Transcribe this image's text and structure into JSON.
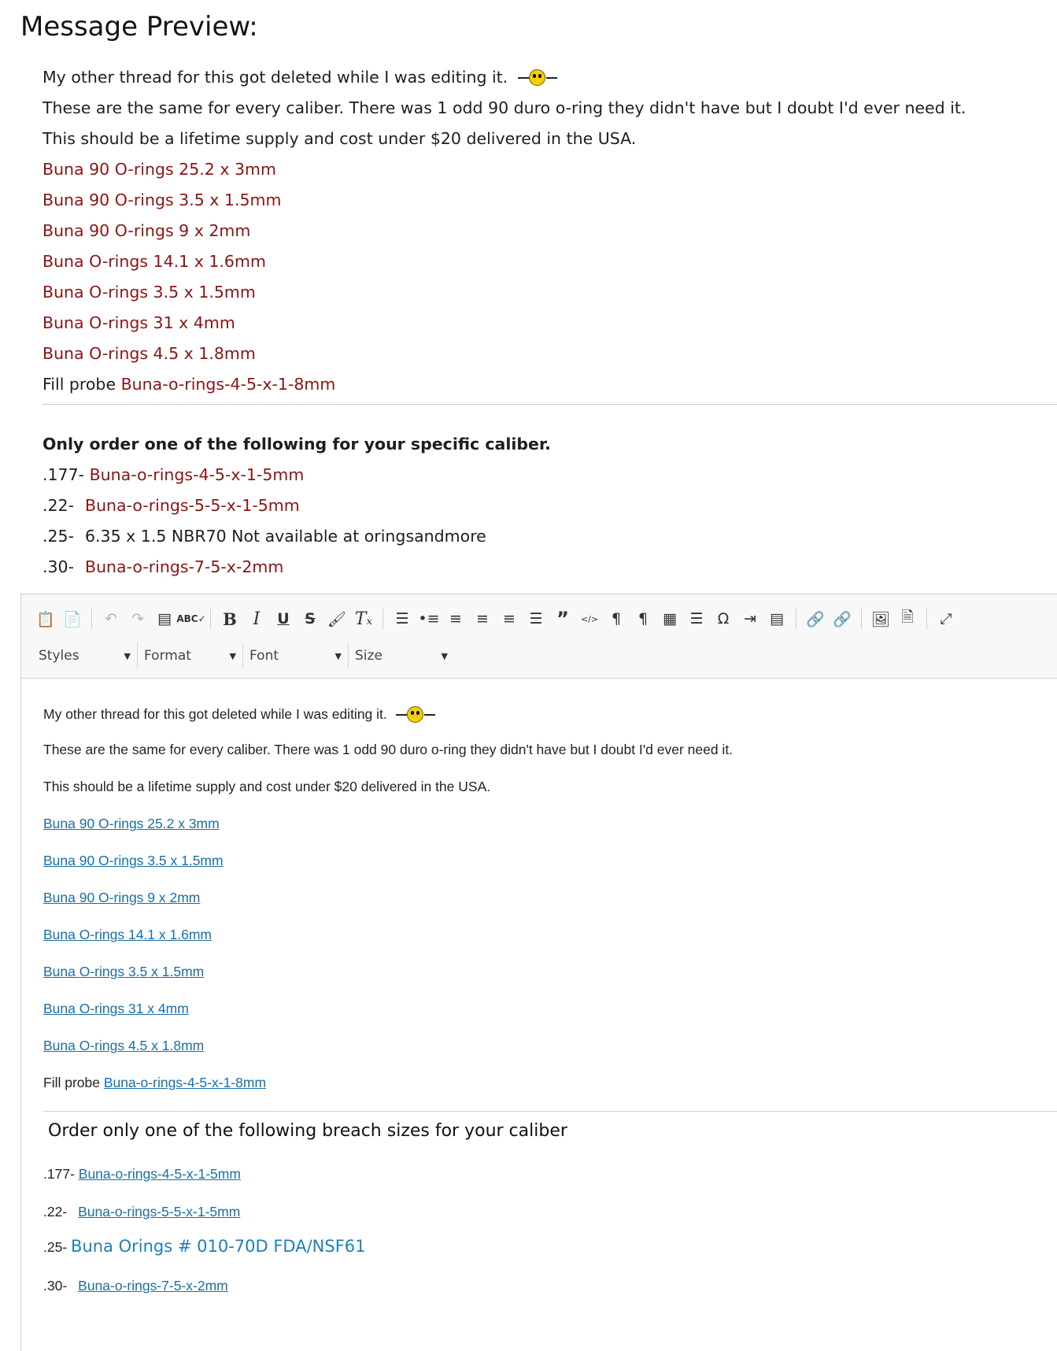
{
  "heading": "Message Preview:",
  "preview": {
    "line1": "My other thread for this got deleted while I was editing it.",
    "line2": "These are the same for every caliber. There was 1 odd 90 duro o-ring they didn't have but I doubt I'd ever need it.",
    "line3": "This should be a lifetime supply and cost under $20 delivered in the USA.",
    "links": [
      "Buna 90 O-rings 25.2 x 3mm",
      "Buna 90 O-rings 3.5 x 1.5mm",
      "Buna 90 O-rings 9 x 2mm",
      "Buna O-rings 14.1 x 1.6mm",
      "Buna O-rings 3.5 x 1.5mm",
      "Buna O-rings 31 x 4mm",
      "Buna O-rings 4.5 x 1.8mm"
    ],
    "fill_label": "Fill probe",
    "fill_link": "Buna-o-rings-4-5-x-1-8mm",
    "subheading": "Only order one of the following for your specific caliber.",
    "calibers": [
      {
        "cal": ".177-",
        "text": "Buna-o-rings-4-5-x-1-5mm"
      },
      {
        "cal": ".22-",
        "text": "Buna-o-rings-5-5-x-1-5mm"
      },
      {
        "cal": ".25-",
        "text": "6.35 x 1.5 NBR70 Not available at oringsandmore"
      },
      {
        "cal": ".30-",
        "text": "Buna-o-rings-7-5-x-2mm"
      }
    ]
  },
  "editor": {
    "combos": [
      "Styles",
      "Format",
      "Font",
      "Size"
    ],
    "line1": "My other thread for this got deleted while I was editing it.",
    "line2": "These are the same for every caliber. There was 1 odd 90 duro o-ring they didn't have but I doubt I'd ever need it.",
    "line3": "This should be a lifetime supply and cost under $20 delivered in the USA.",
    "links": [
      "Buna 90 O-rings 25.2 x 3mm",
      "Buna 90 O-rings 3.5 x 1.5mm",
      "Buna 90 O-rings 9 x 2mm",
      "Buna O-rings 14.1 x 1.6mm",
      "Buna O-rings 3.5 x 1.5mm",
      "Buna O-rings 31 x 4mm",
      "Buna O-rings 4.5 x 1.8mm"
    ],
    "fill_label": "Fill probe",
    "fill_link": "Buna-o-rings-4-5-x-1-8mm",
    "subheading": "Order only one of the following breach sizes for your caliber",
    "calibers": [
      {
        "cal": ".177-",
        "text": "Buna-o-rings-4-5-x-1-5mm"
      },
      {
        "cal": ".22-",
        "text": "Buna-o-rings-5-5-x-1-5mm"
      },
      {
        "cal": ".25-",
        "text": "Buna Orings # 010-70D FDA/NSF61"
      },
      {
        "cal": ".30-",
        "text": "Buna-o-rings-7-5-x-2mm"
      }
    ]
  },
  "colors": {
    "preview_link": "#8b1414",
    "editor_link": "#1a6ea8",
    "toolbar_bg": "#f8f8f8"
  }
}
